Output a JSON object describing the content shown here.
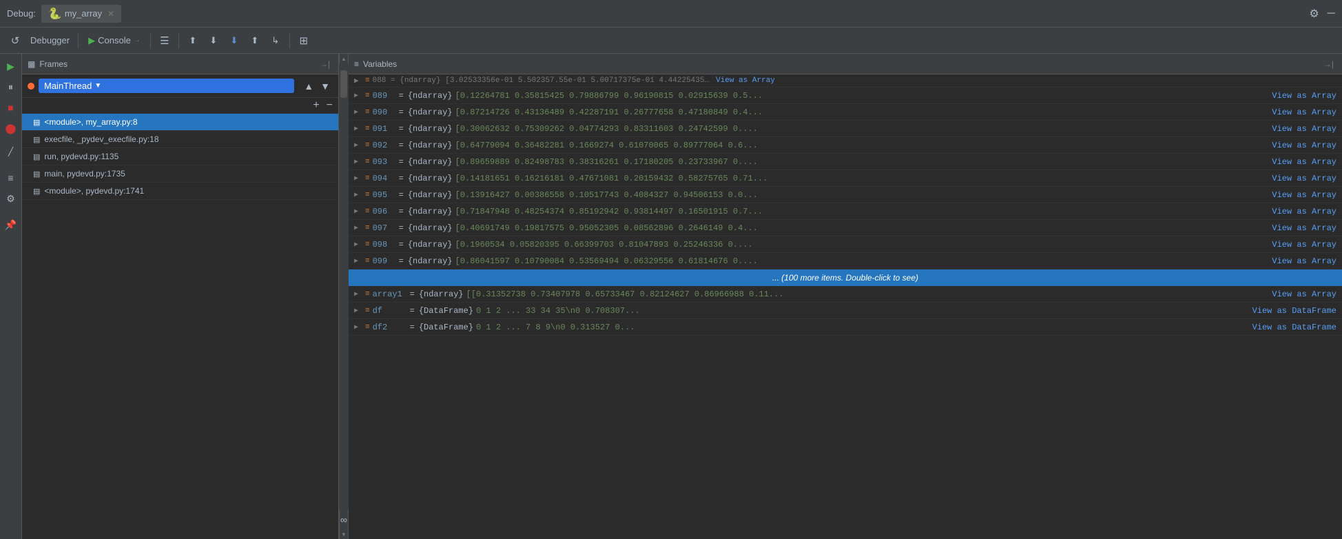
{
  "topbar": {
    "debug_label": "Debug:",
    "tab_name": "my_array",
    "settings_icon": "⚙",
    "minimize_icon": "─"
  },
  "toolbar": {
    "debugger_label": "Debugger",
    "console_label": "Console",
    "console_arrow": "▶",
    "btn_rerun": "↺",
    "btn_menu": "☰",
    "btn_step_over": "↷",
    "btn_step_into": "↓",
    "btn_step_out": "↑",
    "btn_resume": "▶",
    "btn_pause": "⏸",
    "btn_stop": "■",
    "btn_mute": "🔇",
    "btn_view": "⊞"
  },
  "frames_panel": {
    "title": "Frames",
    "pin_label": "→|",
    "frames": [
      {
        "label": "<module>, my_array.py:8",
        "active": true
      },
      {
        "label": "execfile, _pydev_execfile.py:18",
        "active": false
      },
      {
        "label": "run, pydevd.py:1135",
        "active": false
      },
      {
        "label": "main, pydevd.py:1735",
        "active": false
      },
      {
        "label": "<module>, pydevd.py:1741",
        "active": false
      }
    ],
    "thread_name": "MainThread",
    "add_btn": "+",
    "remove_btn": "−"
  },
  "variables_panel": {
    "title": "Variables",
    "pin_label": "→|",
    "top_scroll_hint": "088 = {ndarray} [3.02533356e-01 5.50235 7.55e-01 5.007173 7.5e-01 4.44225 4350...View as Array",
    "rows": [
      {
        "index": "089",
        "type": "{ndarray}",
        "value": "[0.12264781 0.35815425 0.79886799 0.96190815 0.02915639 0.5...",
        "view_label": "View as Array"
      },
      {
        "index": "090",
        "type": "{ndarray}",
        "value": "[0.87214726 0.43136489 0.42287191 0.26777658 0.47180849 0.4...",
        "view_label": "View as Array"
      },
      {
        "index": "091",
        "type": "{ndarray}",
        "value": "[0.30062632 0.75309262 0.04774293 0.83311603 0.24742599 0....",
        "view_label": "View as Array"
      },
      {
        "index": "092",
        "type": "{ndarray}",
        "value": "[0.64779094 0.36482281 0.1669274  0.61070065 0.89777064 0.6...",
        "view_label": "View as Array"
      },
      {
        "index": "093",
        "type": "{ndarray}",
        "value": "[0.89659889 0.82498783 0.38316261 0.17180205 0.23733967 0....",
        "view_label": "View as Array"
      },
      {
        "index": "094",
        "type": "{ndarray}",
        "value": "[0.14181651 0.16216181 0.47671081 0.20159432 0.58275765 0.71...",
        "view_label": "View as Array"
      },
      {
        "index": "095",
        "type": "{ndarray}",
        "value": "[0.13916427 0.00386558 0.10517743 0.4084327  0.94506153 0.0...",
        "view_label": "View as Array"
      },
      {
        "index": "096",
        "type": "{ndarray}",
        "value": "[0.71847948 0.48254374 0.85192942 0.93814497 0.16501915 0.7...",
        "view_label": "View as Array"
      },
      {
        "index": "097",
        "type": "{ndarray}",
        "value": "[0.40691749 0.19817575 0.95052305 0.08562896 0.2646149  0.4...",
        "view_label": "View as Array"
      },
      {
        "index": "098",
        "type": "{ndarray}",
        "value": "[0.1960534  0.05820395 0.66399703 0.81047893 0.25246336 0....",
        "view_label": "View as Array"
      },
      {
        "index": "099",
        "type": "{ndarray}",
        "value": "[0.86041597 0.10790084 0.53569494 0.06329556 0.61814676 0....",
        "view_label": "View as Array"
      }
    ],
    "more_items_label": "... (100 more items. Double-click to see)",
    "extra_rows": [
      {
        "name": "array1",
        "eq": "=",
        "type": "{ndarray}",
        "value": "[[0.31352738 0.73407978 0.65733467 0.82124627 0.86966988 0.11...",
        "view_label": "View as Array"
      },
      {
        "name": "df",
        "eq": "=",
        "type": "{DataFrame}",
        "value": "     0    1    2  ...   33   34   35\\n0  0.708307...",
        "view_label": "View as DataFrame"
      },
      {
        "name": "df2",
        "eq": "=",
        "type": "{DataFrame}",
        "value": "   0  1  2  ...  7  8  9\\n0  0.313527  0...",
        "view_label": "View as DataFrame"
      }
    ]
  }
}
